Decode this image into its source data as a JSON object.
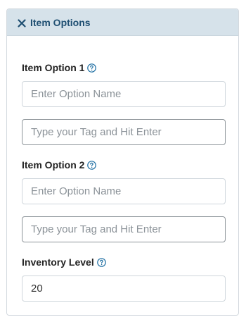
{
  "header": {
    "title": "Item Options"
  },
  "option1": {
    "label": "Item Option 1",
    "name_placeholder": "Enter Option Name",
    "tag_placeholder": "Type your Tag and Hit Enter"
  },
  "option2": {
    "label": "Item Option 2",
    "name_placeholder": "Enter Option Name",
    "tag_placeholder": "Type your Tag and Hit Enter"
  },
  "inventory": {
    "label": "Inventory Level",
    "value": "20"
  },
  "colors": {
    "header_bg": "#d6e2ea",
    "header_text": "#1f4f72",
    "help_icon": "#1f6fa3"
  },
  "icons": {
    "close": "close-icon",
    "help": "help-icon"
  }
}
